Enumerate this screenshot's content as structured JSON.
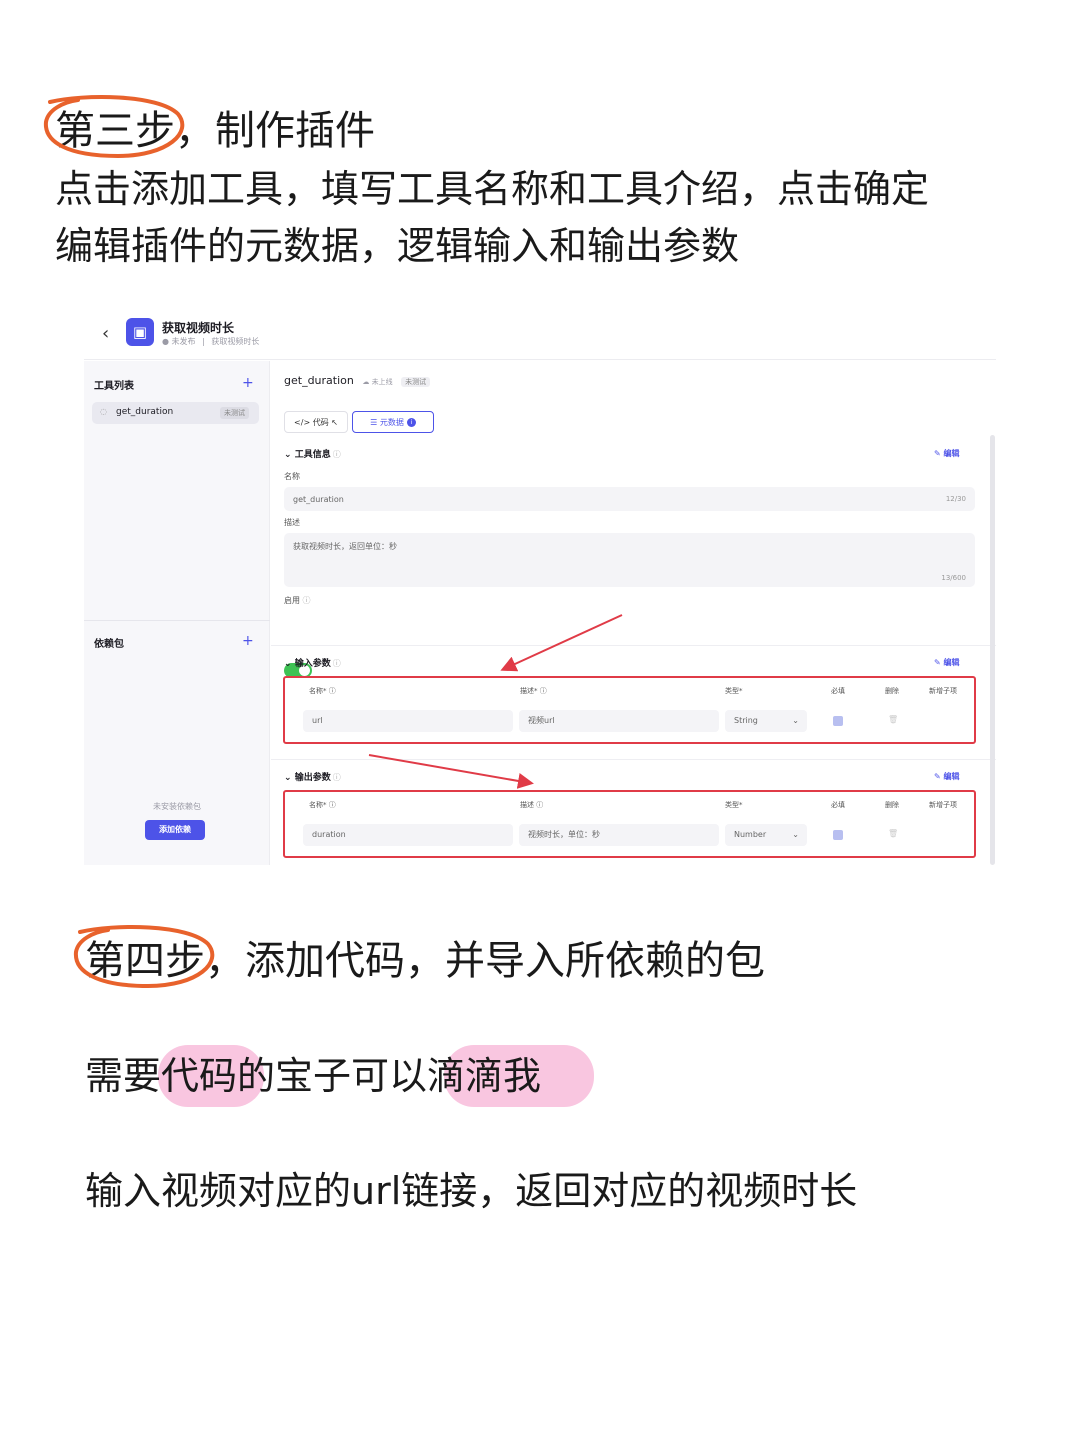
{
  "step3": {
    "tag": "第三步",
    "rest": "，制作插件",
    "line1": "点击添加工具，填写工具名称和工具介绍，点击确定",
    "line2": "编辑插件的元数据，逻辑输入和输出参数"
  },
  "shot": {
    "header": {
      "title": "获取视频时长",
      "status": "● 未发布",
      "desc": "获取视频时长"
    },
    "sidebar": {
      "tools_title": "工具列表",
      "tool_item_name": "get_duration",
      "tool_item_badge": "未测试",
      "deps_title": "依赖包",
      "deps_empty": "未安装依赖包",
      "deps_add": "添加依赖"
    },
    "main": {
      "tool_name": "get_duration",
      "online_status": "未上线",
      "test_badge": "未测试",
      "tab_code": "代码",
      "tab_meta": "元数据",
      "tool_info_title": "工具信息",
      "edit_label": "编辑",
      "name_label": "名称",
      "name_value": "get_duration",
      "name_count": "12/30",
      "desc_label": "描述",
      "desc_value": "获取视频时长，返回单位：秒",
      "desc_count": "13/600",
      "enable_label": "启用",
      "input_title": "输入参数",
      "output_title": "输出参数",
      "col_name": "名称",
      "col_desc": "描述",
      "col_type": "类型",
      "col_required": "必填",
      "col_delete": "删除",
      "col_add_child": "新增子项",
      "input_row": {
        "name": "url",
        "desc": "视频url",
        "type": "String"
      },
      "output_row": {
        "name": "duration",
        "desc": "视频时长，单位：秒",
        "type": "Number"
      }
    },
    "annotation_color": "#e03b47",
    "accent": "#4d53e8"
  },
  "step4": {
    "tag": "第四步",
    "rest": "，添加代码，并导入所依赖的包"
  },
  "line_code": {
    "p1": "需要",
    "h1": "代码",
    "p2": "的宝子可以",
    "h2": "滴滴我"
  },
  "line_url": "输入视频对应的url链接，返回对应的视频时长"
}
